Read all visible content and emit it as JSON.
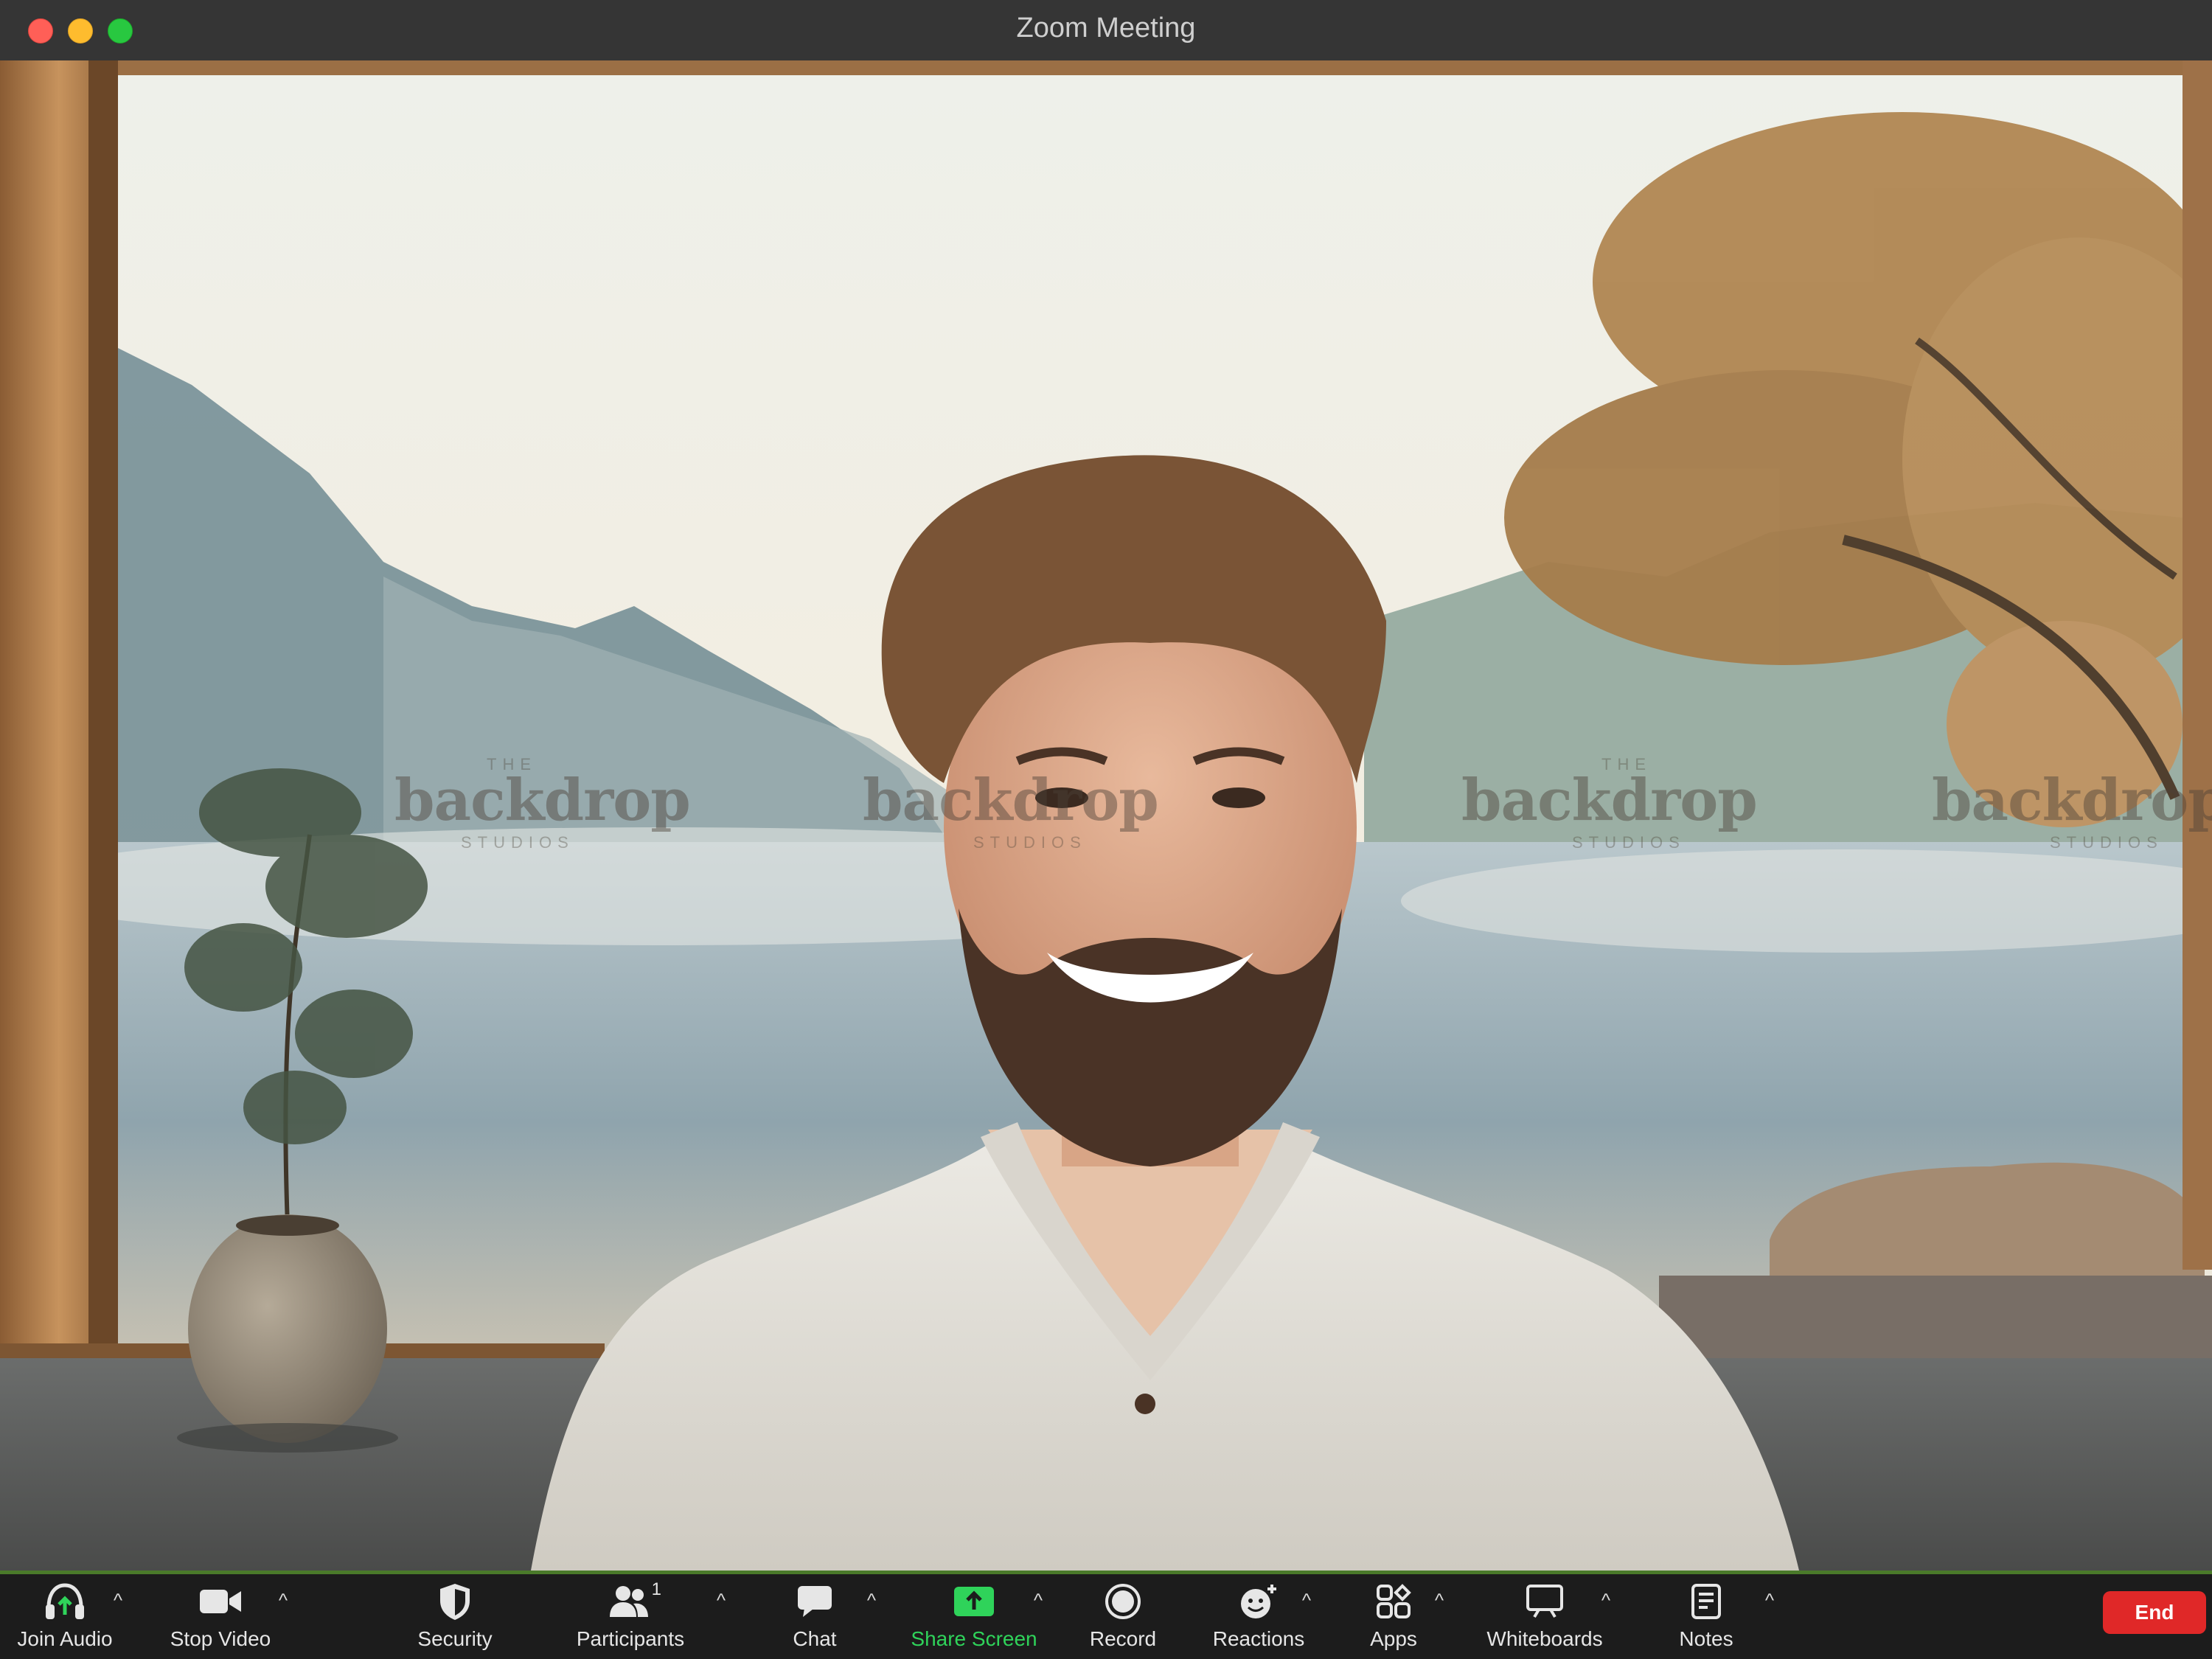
{
  "window": {
    "title": "Zoom Meeting"
  },
  "watermark": {
    "brand": "backdrop",
    "top": "THE",
    "bottom": "STUDIOS"
  },
  "toolbar": {
    "join_audio": "Join Audio",
    "stop_video": "Stop Video",
    "security": "Security",
    "participants": "Participants",
    "participants_count": "1",
    "chat": "Chat",
    "share_screen": "Share Screen",
    "record": "Record",
    "reactions": "Reactions",
    "apps": "Apps",
    "whiteboards": "Whiteboards",
    "notes": "Notes",
    "end": "End"
  },
  "icons": {
    "join_audio": "headphones-icon",
    "stop_video": "video-camera-icon",
    "security": "shield-icon",
    "participants": "people-icon",
    "chat": "chat-bubble-icon",
    "share_screen": "share-arrow-icon",
    "record": "record-icon",
    "reactions": "smiley-plus-icon",
    "apps": "apps-icon",
    "whiteboards": "whiteboard-icon",
    "notes": "notes-icon"
  },
  "colors": {
    "end_button": "#e02828",
    "share_screen": "#2fd35a",
    "toolbar_bg": "#1c1c1c",
    "titlebar_bg": "#353535"
  }
}
